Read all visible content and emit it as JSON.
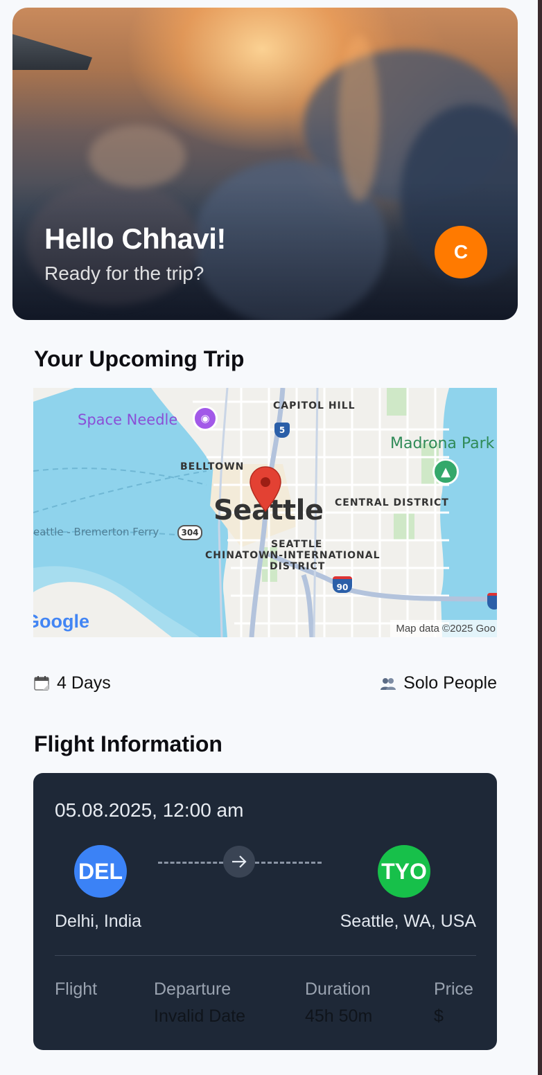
{
  "hero": {
    "greeting": "Hello Chhavi!",
    "subtitle": "Ready for the trip?",
    "avatar_initial": "C",
    "avatar_color": "#ff7a00"
  },
  "upcoming": {
    "title": "Your Upcoming Trip",
    "map": {
      "city_label": "Seattle",
      "labels": {
        "space_needle": "Space Needle",
        "capitol_hill": "CAPITOL HILL",
        "belltown": "BELLTOWN",
        "madrona_park": "Madrona Park",
        "central_district": "CENTRAL DISTRICT",
        "ferry": "eattle - Bremerton Ferry",
        "district_1": "SEATTLE",
        "district_2": "CHINATOWN-INTERNATIONAL",
        "district_3": "DISTRICT",
        "route_5": "5",
        "route_304": "304",
        "route_90": "90",
        "google": "Google",
        "attribution": "Map data ©2025 Goo"
      }
    },
    "duration": "4 Days",
    "people": "Solo People",
    "calendar_icon": "calendar-icon",
    "people_icon": "people-icon"
  },
  "flight": {
    "title": "Flight Information",
    "datetime": "05.08.2025, 12:00 am",
    "from_code": "DEL",
    "from_city": "Delhi, India",
    "from_color": "#3b82f6",
    "to_code": "TYO",
    "to_city": "Seattle, WA, USA",
    "to_color": "#17c04a",
    "columns": [
      {
        "label": "Flight",
        "value": ""
      },
      {
        "label": "Departure",
        "value": "Invalid Date"
      },
      {
        "label": "Duration",
        "value": "45h 50m"
      },
      {
        "label": "Price",
        "value": "$"
      }
    ]
  }
}
